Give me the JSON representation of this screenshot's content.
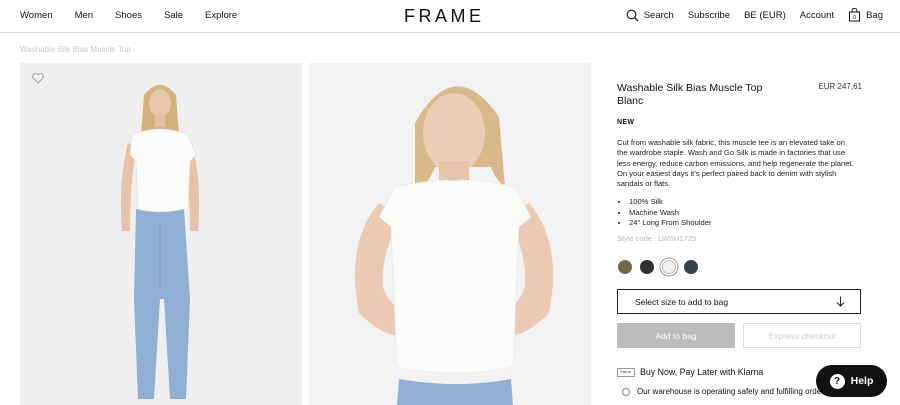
{
  "nav": {
    "left": [
      "Women",
      "Men",
      "Shoes",
      "Sale",
      "Explore"
    ],
    "logo": "FRAME",
    "search": "Search",
    "subscribe": "Subscribe",
    "currency": "BE (EUR)",
    "account": "Account",
    "bag": "Bag",
    "bag_count": "0"
  },
  "breadcrumb": "Washable Silk Bias Muscle Top",
  "product": {
    "title": "Washable Silk Bias Muscle Top Blanc",
    "price": "EUR 247,61",
    "badge": "NEW",
    "description": "Cut from washable silk fabric, this muscle tee is an elevated take on the wardrobe staple. Wash and Go Silk is made in factories that use less energy, reduce carbon emissions, and help regenerate the planet. On your easiest days it’s perfect paired back to denim with stylish sandals or flats.",
    "features": [
      "100% Silk",
      "Machine Wash",
      "24\" Long From Shoulder"
    ],
    "style_code": "Style code : LWSH1729",
    "swatches": [
      {
        "color": "#6d6a4a",
        "selected": false
      },
      {
        "color": "#2f3131",
        "selected": false
      },
      {
        "color": "#f4f2ee",
        "selected": true
      },
      {
        "color": "#3a3f52",
        "selected": false
      }
    ]
  },
  "actions": {
    "select_size": "Select size to add to bag",
    "add_to_bag": "Add to bag",
    "express_checkout": "Express checkout"
  },
  "klarna": {
    "logo": "Klarna.",
    "text": "Buy Now, Pay Later with Klarna"
  },
  "warehouse": "Our warehouse is operating safely and fulfilling orders",
  "help": "Help"
}
